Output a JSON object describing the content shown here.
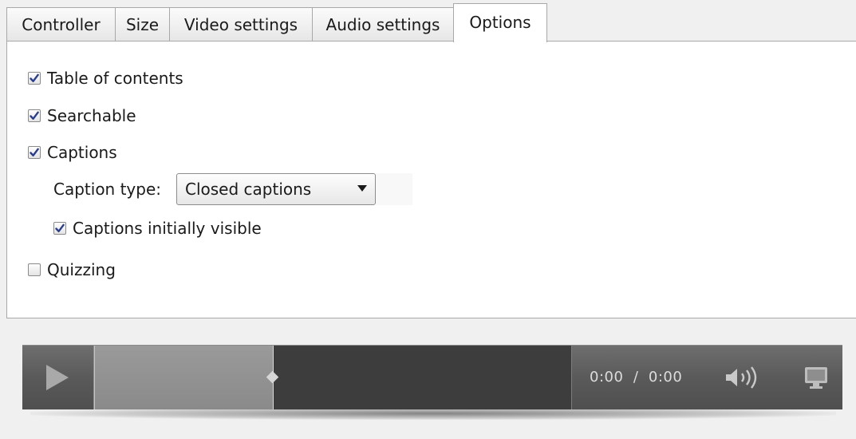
{
  "tabs": [
    {
      "label": "Controller",
      "active": false
    },
    {
      "label": "Size",
      "active": false
    },
    {
      "label": "Video settings",
      "active": false
    },
    {
      "label": "Audio settings",
      "active": false
    },
    {
      "label": "Options",
      "active": true
    }
  ],
  "options": {
    "table_of_contents": {
      "label": "Table of contents",
      "checked": true
    },
    "searchable": {
      "label": "Searchable",
      "checked": true
    },
    "captions": {
      "label": "Captions",
      "checked": true
    },
    "caption_type": {
      "label": "Caption type:",
      "value": "Closed captions"
    },
    "captions_initially_visible": {
      "label": "Captions initially visible",
      "checked": true
    },
    "quizzing": {
      "label": "Quizzing",
      "checked": false
    }
  },
  "player": {
    "current_time": "0:00",
    "separator": "/",
    "duration": "0:00",
    "progress": 0.375,
    "icons": [
      "play-icon",
      "volume-icon",
      "fullscreen-icon"
    ]
  },
  "colors": {
    "checkmark": "#2b3e8c",
    "player_bar": "#5a5a5a",
    "seek_track": "#3d3d3d"
  }
}
